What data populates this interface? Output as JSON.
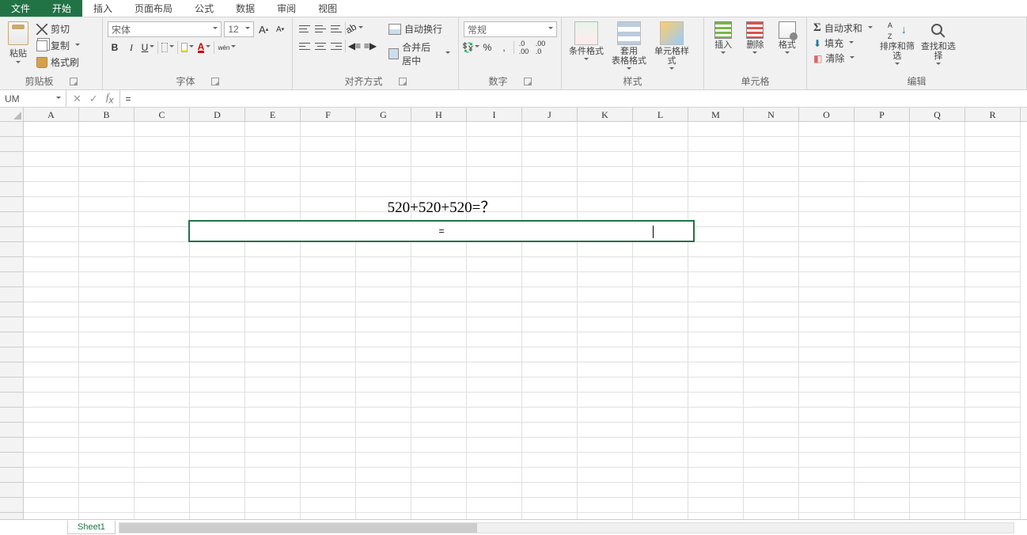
{
  "tabs": {
    "file": "文件",
    "home": "开始",
    "insert": "插入",
    "layout": "页面布局",
    "formulas": "公式",
    "data": "数据",
    "review": "审阅",
    "view": "视图"
  },
  "ribbon": {
    "clipboard": {
      "paste": "粘贴",
      "cut": "剪切",
      "copy": "复制",
      "brush": "格式刷",
      "label": "剪贴板"
    },
    "font": {
      "name": "宋体",
      "size": "12",
      "incA": "A",
      "decA": "A",
      "bold": "B",
      "italic": "I",
      "underline": "U",
      "pinyin": "wén",
      "label": "字体"
    },
    "align": {
      "wrap": "自动换行",
      "merge": "合并后居中",
      "label": "对齐方式"
    },
    "number": {
      "format": "常规",
      "label": "数字"
    },
    "styles": {
      "cond": "条件格式",
      "table": "套用\n表格格式",
      "cell": "单元格样式",
      "label": "样式"
    },
    "cells": {
      "insert": "插入",
      "delete": "删除",
      "format": "格式",
      "label": "单元格"
    },
    "editing": {
      "sum": "自动求和",
      "fill": "填充",
      "clear": "清除",
      "sort": "排序和筛选",
      "find": "查找和选择",
      "label": "编辑"
    }
  },
  "formula_bar": {
    "name_box": "UM",
    "content": "="
  },
  "columns": [
    "A",
    "B",
    "C",
    "D",
    "E",
    "F",
    "G",
    "H",
    "I",
    "J",
    "K",
    "L",
    "M",
    "N",
    "O",
    "P",
    "Q",
    "R"
  ],
  "grid": {
    "question_cell": "520+520+520=？",
    "editing_cell": "="
  },
  "sheet": {
    "tab1": "Sheet1"
  },
  "colors": {
    "excel_green": "#217346"
  }
}
